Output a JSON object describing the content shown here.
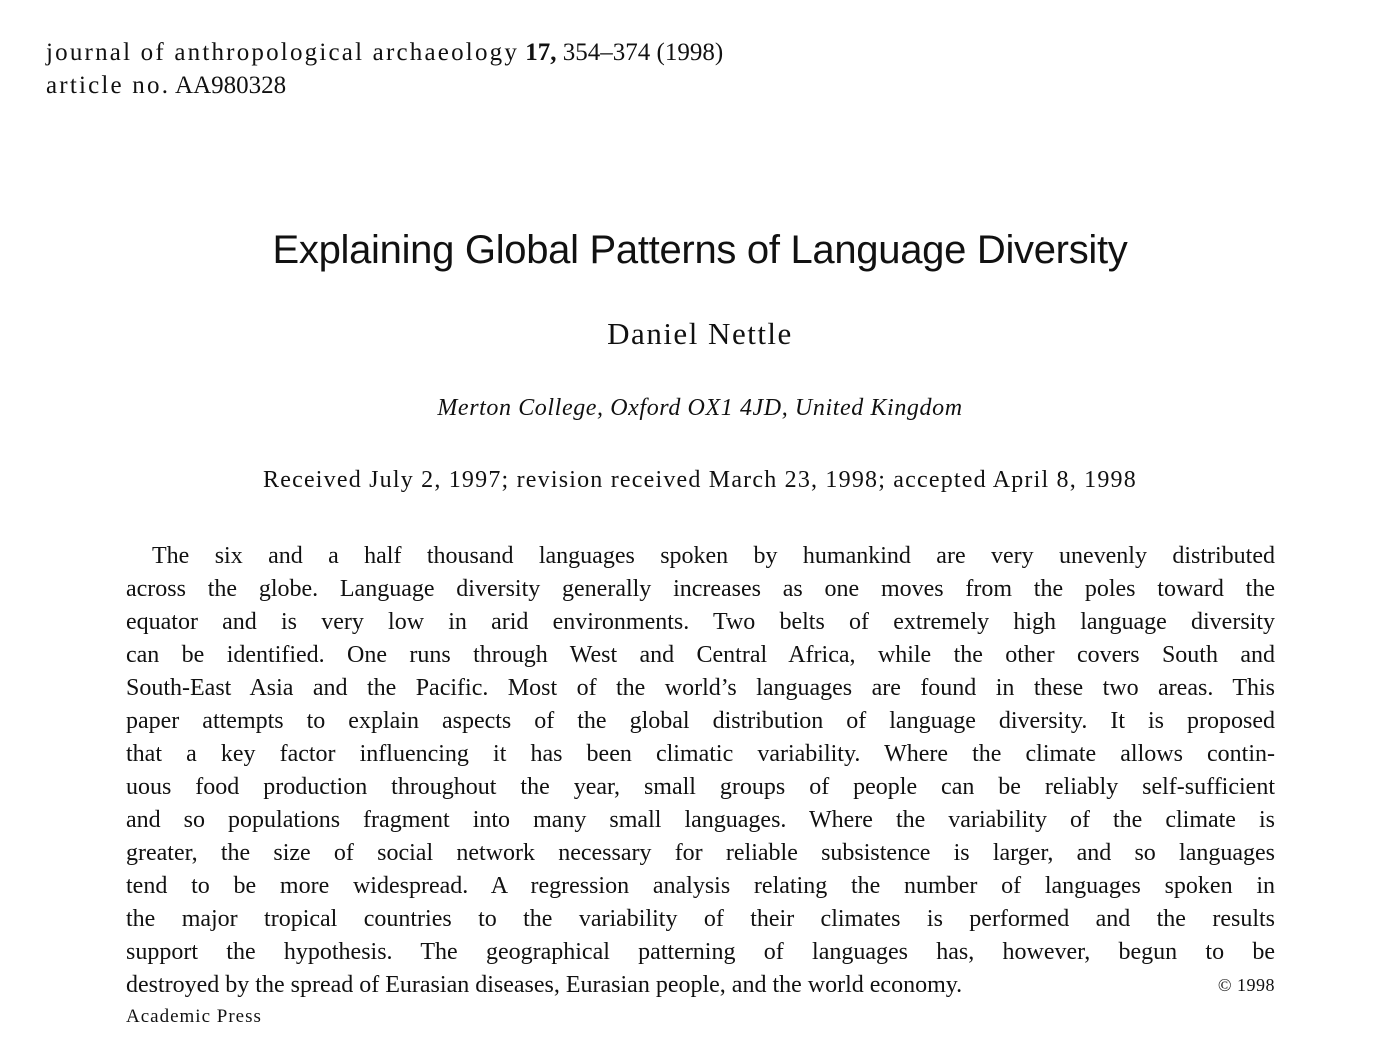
{
  "header": {
    "journal": "journal of anthropological archaeology",
    "volume": "17,",
    "pages_year": "354–374 (1998)",
    "article_no_label": "article no.",
    "article_no": "AA980328"
  },
  "title": "Explaining Global Patterns of Language Diversity",
  "author": "Daniel Nettle",
  "affiliation": "Merton College, Oxford OX1 4JD, United Kingdom",
  "dates": "Received July 2, 1997; revision received March 23, 1998; accepted April 8, 1998",
  "abstract": {
    "lines": [
      "The six and a half thousand languages spoken by humankind are very unevenly distributed",
      "across the globe. Language diversity generally increases as one moves from the poles toward the",
      "equator and is very low in arid environments. Two belts of extremely high language diversity",
      "can be identified. One runs through West and Central Africa, while the other covers South and",
      "South-East Asia and the Pacific. Most of the world’s languages are found in these two areas. This",
      "paper attempts to explain aspects of the global distribution of language diversity. It is proposed",
      "that a key factor influencing it has been climatic variability. Where the climate allows contin-",
      "uous food production throughout the year, small groups of people can be reliably self-sufficient",
      "and so populations fragment into many small languages. Where the variability of the climate is",
      "greater, the size of social network necessary for reliable subsistence is larger, and so languages",
      "tend to be more widespread. A regression analysis relating the number of languages spoken in",
      "the major tropical countries to the variability of their climates is performed and the results",
      "support the hypothesis. The geographical patterning of languages has, however, begun to be",
      "destroyed by the spread of Eurasian diseases, Eurasian people, and the world economy."
    ],
    "copyright": "© 1998",
    "publisher": "Academic Press"
  }
}
